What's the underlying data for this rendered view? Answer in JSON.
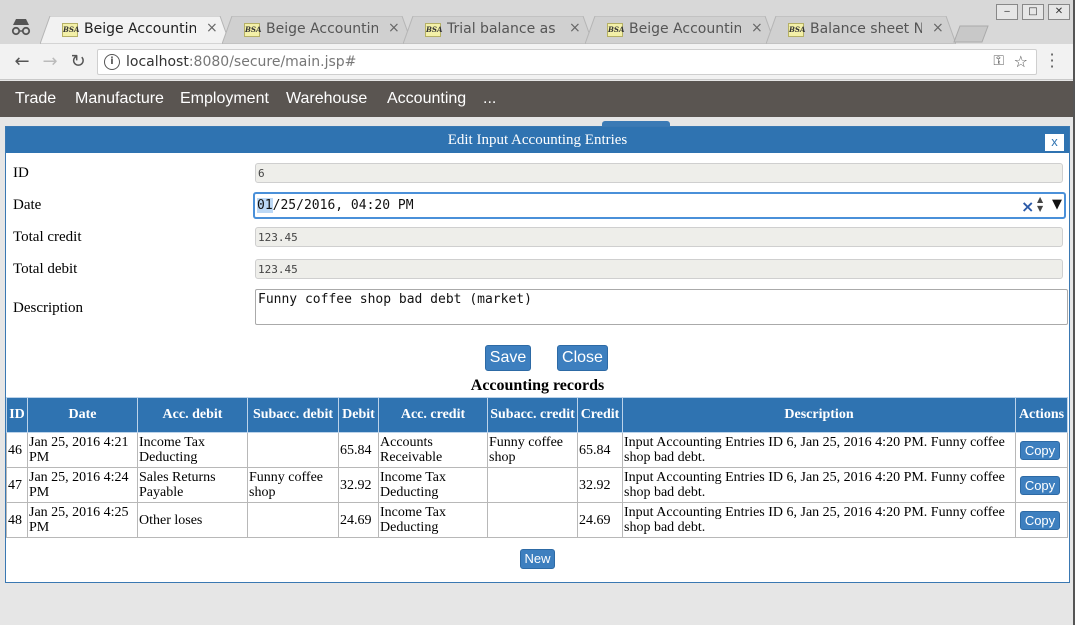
{
  "browser": {
    "tabs": [
      {
        "favicon": "BSA",
        "title": "Beige Accounting",
        "active": true
      },
      {
        "favicon": "BSA",
        "title": "Beige Accounting",
        "active": false
      },
      {
        "favicon": "BSA",
        "title": "Trial balance as at",
        "active": false
      },
      {
        "favicon": "BSA",
        "title": "Beige Accounting",
        "active": false
      },
      {
        "favicon": "BSA",
        "title": "Balance sheet Nov",
        "active": false
      }
    ],
    "tab_close": "×",
    "window_buttons": [
      "‒",
      "□",
      "✕"
    ],
    "url_host": "localhost",
    "url_rest": ":8080/secure/main.jsp#",
    "icons": {
      "back": "arrow-left-icon",
      "forward": "arrow-right-icon",
      "reload": "reload-icon",
      "info": "info-icon",
      "key": "key-icon",
      "star": "star-icon",
      "menu": "kebab-menu-icon",
      "incognito": "incognito-icon"
    }
  },
  "app_nav": [
    "Trade",
    "Manufacture",
    "Employment",
    "Warehouse",
    "Accounting",
    "..."
  ],
  "dialog": {
    "title": "Edit Input Accounting Entries",
    "close_label": "x",
    "fields": {
      "id_label": "ID",
      "id_value": "6",
      "date_label": "Date",
      "date_value_sel": "01",
      "date_value_rest": "/25/2016, 04:20 PM",
      "date_clear": "×",
      "date_spin": "▲▼",
      "date_drop": "▼",
      "credit_label": "Total credit",
      "credit_value": "123.45",
      "debit_label": "Total debit",
      "debit_value": "123.45",
      "desc_label": "Description",
      "desc_value": "Funny coffee shop bad debt (market)"
    },
    "save_label": "Save",
    "close_button_label": "Close",
    "records_title": "Accounting records",
    "records_headers": [
      "ID",
      "Date",
      "Acc. debit",
      "Subacc. debit",
      "Debit",
      "Acc. credit",
      "Subacc. credit",
      "Credit",
      "Description",
      "Actions"
    ],
    "records": [
      {
        "id": "46",
        "date": "Jan 25, 2016 4:21 PM",
        "acc_debit": "Income Tax Deducting",
        "subacc_debit": "",
        "debit": "65.84",
        "acc_credit": "Accounts Receivable",
        "subacc_credit": "Funny coffee shop",
        "credit": "65.84",
        "description": "Input Accounting Entries ID 6, Jan 25, 2016 4:20 PM. Funny coffee shop bad debt.",
        "action": "Copy"
      },
      {
        "id": "47",
        "date": "Jan 25, 2016 4:24 PM",
        "acc_debit": "Sales Returns Payable",
        "subacc_debit": "Funny coffee shop",
        "debit": "32.92",
        "acc_credit": "Income Tax Deducting",
        "subacc_credit": "",
        "credit": "32.92",
        "description": "Input Accounting Entries ID 6, Jan 25, 2016 4:20 PM. Funny coffee shop bad debt.",
        "action": "Copy"
      },
      {
        "id": "48",
        "date": "Jan 25, 2016 4:25 PM",
        "acc_debit": "Other loses",
        "subacc_debit": "",
        "debit": "24.69",
        "acc_credit": "Income Tax Deducting",
        "subacc_credit": "",
        "credit": "24.69",
        "description": "Input Accounting Entries ID 6, Jan 25, 2016 4:20 PM. Funny coffee shop bad debt.",
        "action": "Copy"
      }
    ],
    "new_label": "New"
  }
}
